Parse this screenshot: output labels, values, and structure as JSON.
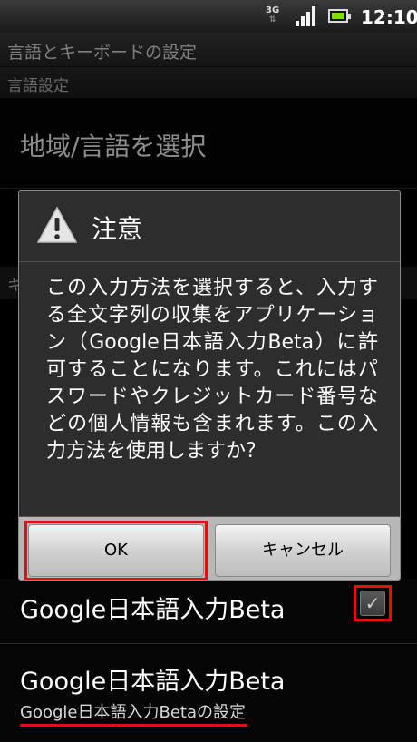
{
  "status_bar": {
    "network_type": "3G",
    "network_arrows": "⇅",
    "time": "12:10",
    "colors": {
      "battery_level": "#7ee000"
    }
  },
  "app_bar": {
    "title": "言語とキーボードの設定"
  },
  "screen": {
    "section_header": "言語設定",
    "region_item": "地域/言語を選択",
    "partial_section_initial": "キ",
    "ime_item": {
      "label": "Google日本語入力Beta",
      "checked": true,
      "check_glyph": "✓"
    },
    "ime_settings_item": {
      "title": "Google日本語入力Beta",
      "summary": "Google日本語入力Betaの設定"
    }
  },
  "dialog": {
    "icon": "warning-icon",
    "title": "注意",
    "message": "この入力方法を選択すると、入力する全文字列の収集をアプリケーション（Google日本語入力Beta）に許可することになります。これにはパスワードやクレジットカード番号などの個人情報も含まれます。この入力方法を使用しますか？",
    "ok_label": "OK",
    "cancel_label": "キャンセル",
    "colors": {
      "highlight": "#e01010"
    }
  }
}
